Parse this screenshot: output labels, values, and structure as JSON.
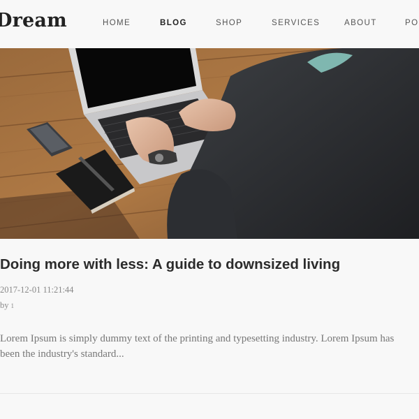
{
  "site": {
    "logo_text": "Dream"
  },
  "nav": {
    "items": [
      {
        "label": "HOME"
      },
      {
        "label": "BLOG"
      },
      {
        "label": "SHOP"
      },
      {
        "label": "SERVICES"
      },
      {
        "label": "ABOUT"
      },
      {
        "label": "PO"
      }
    ],
    "active": "BLOG"
  },
  "post": {
    "image_icon": "laptop-desk-photo",
    "title": "Doing more with less: A guide to downsized living",
    "date": "2017-12-01 11:21:44",
    "by_label": "by",
    "author": "1",
    "excerpt_line1": "Lorem Ipsum is simply dummy text of the printing and typesetting industry. Lorem Ipsum has",
    "excerpt_line2": "been the industry's standard..."
  },
  "colors": {
    "background": "#f8f8f8",
    "text_dark": "#2b2b2b",
    "text_muted": "#888888",
    "nav_text": "#555555"
  }
}
